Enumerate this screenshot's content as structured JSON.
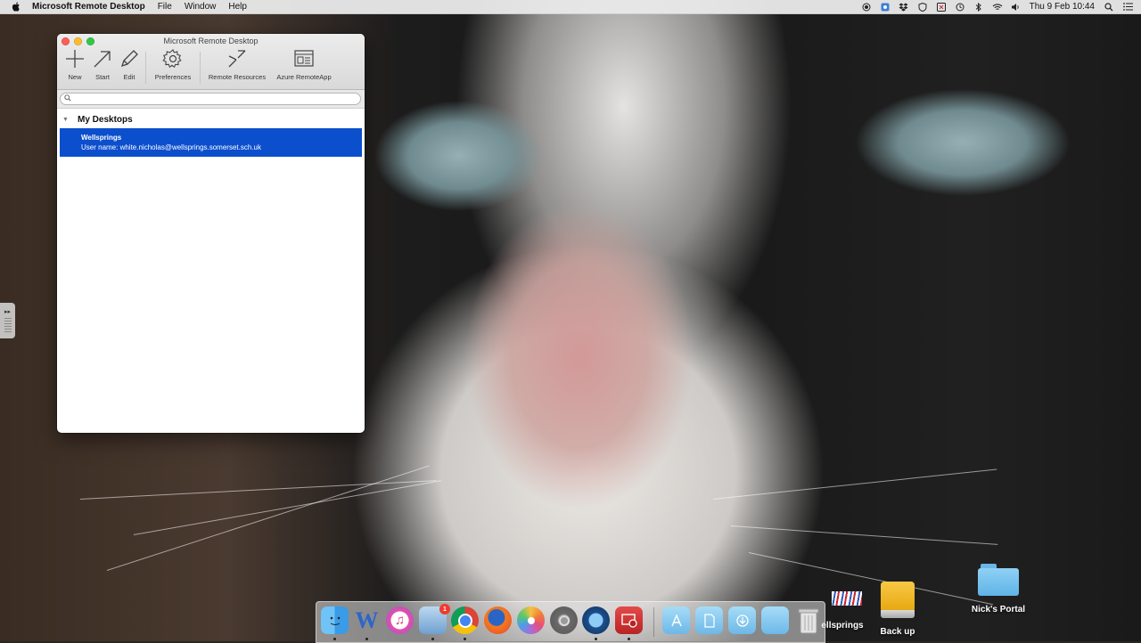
{
  "menubar": {
    "app_name": "Microsoft Remote Desktop",
    "items": [
      "File",
      "Window",
      "Help"
    ],
    "clock": "Thu 9 Feb  10:44"
  },
  "window": {
    "title": "Microsoft Remote Desktop",
    "toolbar": {
      "new_label": "New",
      "start_label": "Start",
      "edit_label": "Edit",
      "preferences_label": "Preferences",
      "remote_resources_label": "Remote Resources",
      "azure_label": "Azure RemoteApp"
    },
    "search": {
      "placeholder": ""
    },
    "groups": [
      {
        "name": "My Desktops",
        "items": [
          {
            "name": "Wellsprings",
            "detail": "User name: white.nicholas@wellsprings.somerset.sch.uk"
          }
        ]
      }
    ]
  },
  "desktop": {
    "icons": [
      {
        "label": "ellsprings",
        "icon": "remote-desktop-shortcut-icon"
      },
      {
        "label": "Back up",
        "icon": "external-drive-icon"
      },
      {
        "label": "Nick's Portal",
        "icon": "folder-icon"
      }
    ]
  },
  "dock": {
    "apps": [
      "finder-icon",
      "word-icon",
      "itunes-icon",
      "preview-icon",
      "chrome-icon",
      "firefox-icon",
      "photos-icon",
      "system-preferences-icon",
      "quicktime-icon",
      "remote-desktop-icon"
    ],
    "preview_badge": "1",
    "folders": [
      "applications-folder-icon",
      "documents-folder-icon",
      "downloads-folder-icon",
      "folder-icon",
      "trash-icon"
    ]
  },
  "colors": {
    "selection": "#0b4fcc",
    "dock_word": "#2b66c9",
    "dock_remote_desktop": "#d13636"
  }
}
